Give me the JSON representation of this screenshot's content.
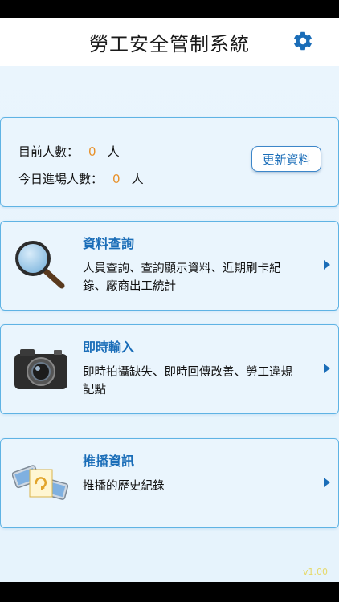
{
  "header": {
    "title": "勞工安全管制系統",
    "settings_icon": "gear-icon"
  },
  "counts": {
    "current_label": "目前人數：",
    "current_value": "0",
    "current_unit": "人",
    "today_label": "今日進場人數：",
    "today_value": "0",
    "today_unit": "人",
    "refresh_label": "更新資料"
  },
  "menu": [
    {
      "title": "資料查詢",
      "desc": "人員查詢、查詢顯示資料、近期刷卡紀錄、廠商出工統計",
      "icon": "magnifier-icon"
    },
    {
      "title": "即時輸入",
      "desc": "即時拍攝缺失、即時回傳改善、勞工違規記點",
      "icon": "camera-icon"
    },
    {
      "title": "推播資訊",
      "desc": "推播的歷史紀錄",
      "icon": "phone-sync-icon"
    }
  ],
  "footer": {
    "version": "v1.00"
  },
  "colors": {
    "accent": "#1a6db8",
    "border": "#5fb3e4",
    "count": "#e8912a",
    "background": "#eaf5fd"
  }
}
